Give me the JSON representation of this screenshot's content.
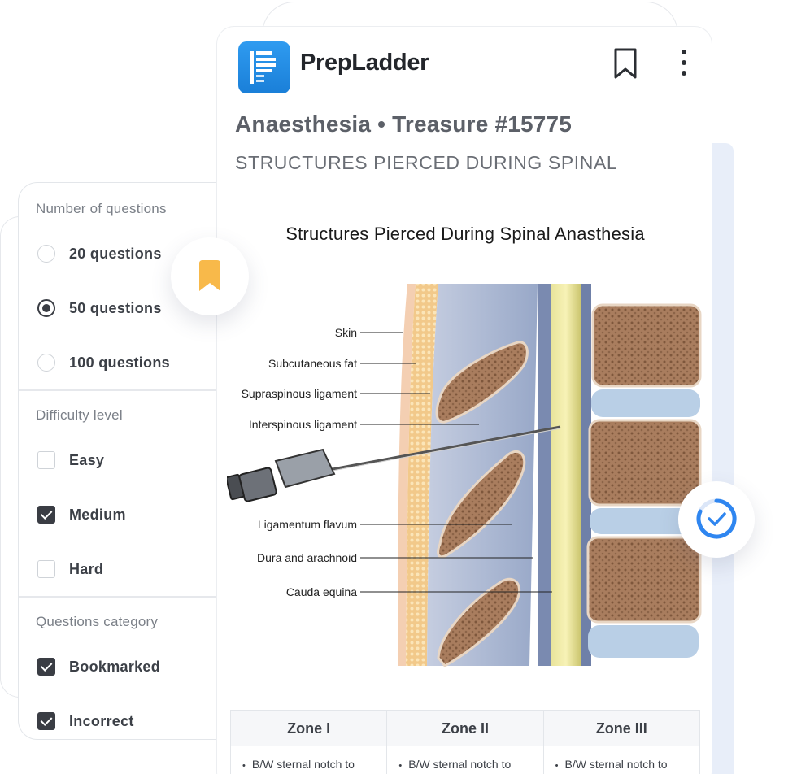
{
  "filters": {
    "sections": [
      {
        "title": "Number of questions",
        "options": [
          {
            "label": "20 questions",
            "selected": false
          },
          {
            "label": "50 questions",
            "selected": true
          },
          {
            "label": "100 questions",
            "selected": false
          }
        ]
      },
      {
        "title": "Difficulty level",
        "options": [
          {
            "label": "Easy",
            "checked": false
          },
          {
            "label": "Medium",
            "checked": true
          },
          {
            "label": "Hard",
            "checked": false
          }
        ]
      },
      {
        "title": "Questions category",
        "options": [
          {
            "label": "Bookmarked",
            "checked": true
          },
          {
            "label": "Incorrect",
            "checked": true
          }
        ]
      }
    ]
  },
  "header": {
    "brand": "PrepLadder",
    "icons": [
      "bookmark-outline-icon",
      "more-vertical-icon"
    ]
  },
  "content": {
    "title": "Anaesthesia • Treasure #15775",
    "subtitle": "STRUCTURES PIERCED DURING SPINAL",
    "figure": {
      "title": "Structures Pierced During Spinal Anasthesia",
      "labels": [
        "Skin",
        "Subcutaneous fat",
        "Supraspinous ligament",
        "Interspinous ligament",
        "Ligamentum flavum",
        "Dura and arachnoid",
        "Cauda equina"
      ]
    },
    "zones": {
      "headers": [
        "Zone I",
        "Zone II",
        "Zone III"
      ],
      "rows": [
        [
          "B/W sternal notch to",
          "B/W sternal notch to",
          "B/W sternal notch to"
        ]
      ]
    }
  },
  "bubbles": {
    "bookmark_color": "#f8b94a",
    "progress_color": "#2f86f0"
  },
  "colors": {
    "brand_blue": "#1f88e0",
    "checked_dark": "#3a3d44",
    "strip_blue": "#e8eef9"
  }
}
